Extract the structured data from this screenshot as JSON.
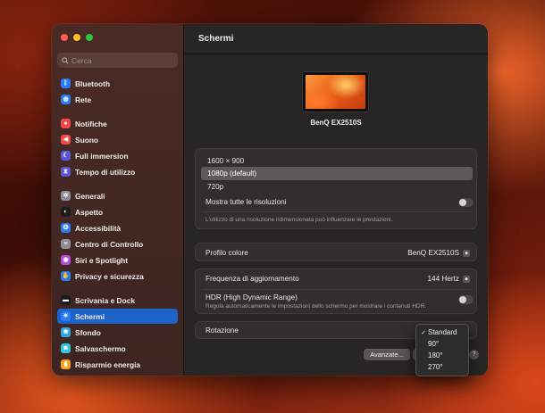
{
  "sidebar": {
    "search_placeholder": "Cerca",
    "items": [
      {
        "label": "Bluetooth",
        "icon": "bluetooth-icon",
        "color": "#2a7bf6"
      },
      {
        "label": "Rete",
        "icon": "globe-icon",
        "color": "#2a7bf6"
      },
      {
        "label": "Notifiche",
        "icon": "bell-icon",
        "color": "#f24848"
      },
      {
        "label": "Suono",
        "icon": "speaker-icon",
        "color": "#f24848"
      },
      {
        "label": "Full immersion",
        "icon": "moon-icon",
        "color": "#5e55d8"
      },
      {
        "label": "Tempo di utilizzo",
        "icon": "hourglass-icon",
        "color": "#5e55d8"
      },
      {
        "label": "Generali",
        "icon": "gear-icon",
        "color": "#8e8e93"
      },
      {
        "label": "Aspetto",
        "icon": "appearance-icon",
        "color": "#1c1c1e"
      },
      {
        "label": "Accessibilità",
        "icon": "accessibility-icon",
        "color": "#2a7bf6"
      },
      {
        "label": "Centro di Controllo",
        "icon": "control-center-icon",
        "color": "#8e8e93"
      },
      {
        "label": "Siri e Spotlight",
        "icon": "siri-icon",
        "color": "#b44ad8"
      },
      {
        "label": "Privacy e sicurezza",
        "icon": "hand-icon",
        "color": "#2a7bf6"
      },
      {
        "label": "Scrivania e Dock",
        "icon": "dock-icon",
        "color": "#1c1c1e"
      },
      {
        "label": "Schermi",
        "icon": "sun-icon",
        "color": "#2a7bf6",
        "selected": true
      },
      {
        "label": "Sfondo",
        "icon": "wallpaper-icon",
        "color": "#32a8e0"
      },
      {
        "label": "Salvaschermo",
        "icon": "screensaver-icon",
        "color": "#32c4e0"
      },
      {
        "label": "Risparmio energia",
        "icon": "battery-icon",
        "color": "#f5a623"
      }
    ]
  },
  "main": {
    "title": "Schermi",
    "monitor_name": "BenQ EX2510S",
    "resolutions": [
      "1600 × 900",
      "1080p (default)",
      "720p"
    ],
    "selected_resolution": 1,
    "show_all_label": "Mostra tutte le risoluzioni",
    "resolution_note": "L'utilizzo di una risoluzione ridimensionata può influenzare le prestazioni.",
    "color_profile": {
      "label": "Profilo colore",
      "value": "BenQ EX2510S"
    },
    "refresh_rate": {
      "label": "Frequenza di aggiornamento",
      "value": "144 Hertz"
    },
    "hdr": {
      "label": "HDR (High Dynamic Range)",
      "description": "Regola automaticamente le impostazioni dello schermo per mostrare i contenuti HDR."
    },
    "rotation": {
      "label": "Rotazione"
    },
    "advanced_button": "Avanzate...",
    "help_button": "?"
  },
  "rotation_dropdown": {
    "options": [
      "Standard",
      "90°",
      "180°",
      "270°"
    ],
    "selected": 0,
    "check": "✓"
  }
}
